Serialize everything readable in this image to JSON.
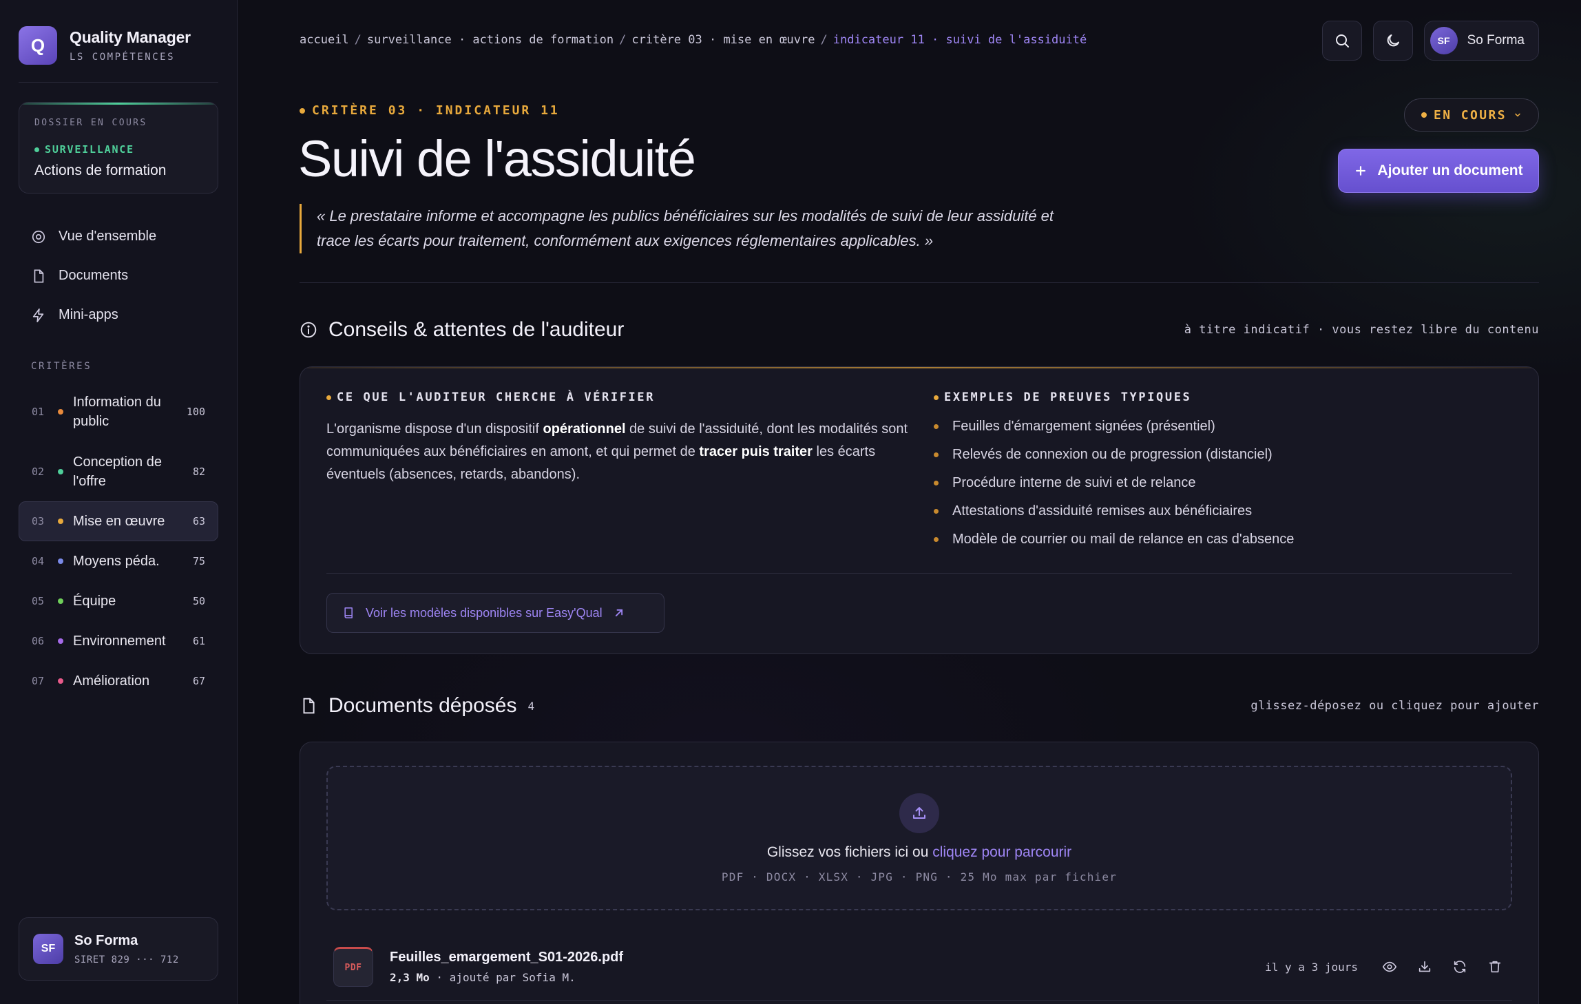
{
  "colors": {
    "accent": "#9f86f5",
    "orange": "#e8a93c",
    "green": "#4fcf9a"
  },
  "brand": {
    "logo_letter": "Q",
    "title": "Quality Manager",
    "subtitle": "LS COMPÉTENCES"
  },
  "dossier": {
    "label": "DOSSIER EN COURS",
    "tag": "SURVEILLANCE",
    "name": "Actions de formation"
  },
  "nav": [
    {
      "label": "Vue d'ensemble",
      "icon": "target-icon"
    },
    {
      "label": "Documents",
      "icon": "file-icon"
    },
    {
      "label": "Mini-apps",
      "icon": "lightning-icon"
    }
  ],
  "criteria": {
    "label": "CRITÈRES",
    "items": [
      {
        "num": "01",
        "name": "Information du public",
        "score": "100",
        "color": "#e88a3c"
      },
      {
        "num": "02",
        "name": "Conception de l'offre",
        "score": "82",
        "color": "#4fcf9a"
      },
      {
        "num": "03",
        "name": "Mise en œuvre",
        "score": "63",
        "color": "#e8a93c"
      },
      {
        "num": "04",
        "name": "Moyens péda.",
        "score": "75",
        "color": "#7a8ae8"
      },
      {
        "num": "05",
        "name": "Équipe",
        "score": "50",
        "color": "#6fcf5a"
      },
      {
        "num": "06",
        "name": "Environnement",
        "score": "61",
        "color": "#a56ae8"
      },
      {
        "num": "07",
        "name": "Amélioration",
        "score": "67",
        "color": "#e85a8a"
      }
    ]
  },
  "user": {
    "initials": "SF",
    "name": "So Forma",
    "siret": "SIRET 829 ··· 712"
  },
  "breadcrumb": {
    "parts": [
      "accueil",
      "surveillance · actions de formation",
      "critère 03 · mise en œuvre"
    ],
    "current": "indicateur 11 · suivi de l'assiduité"
  },
  "header": {
    "eyebrow": "CRITÈRE 03 · INDICATEUR 11",
    "title": "Suivi de l'assiduité",
    "status": "EN COURS",
    "add_button": "Ajouter un document",
    "quote": "« Le prestataire informe et accompagne les publics bénéficiaires sur les modalités de suivi de leur assiduité et trace les écarts pour traitement, conformément aux exigences réglementaires applicables. »"
  },
  "advice": {
    "title": "Conseils & attentes de l'auditeur",
    "hint": "à titre indicatif · vous restez libre du contenu",
    "left_label": "CE QUE L'AUDITEUR CHERCHE À VÉRIFIER",
    "left_text_1": "L'organisme dispose d'un dispositif ",
    "left_bold_1": "opérationnel",
    "left_text_2": " de suivi de l'assiduité, dont les modalités sont communiquées aux bénéficiaires en amont, et qui permet de ",
    "left_bold_2": "tracer puis traiter",
    "left_text_3": " les écarts éventuels (absences, retards, abandons).",
    "right_label": "EXEMPLES DE PREUVES TYPIQUES",
    "examples": [
      "Feuilles d'émargement signées (présentiel)",
      "Relevés de connexion ou de progression (distanciel)",
      "Procédure interne de suivi et de relance",
      "Attestations d'assiduité remises aux bénéficiaires",
      "Modèle de courrier ou mail de relance en cas d'absence"
    ],
    "models_link": "Voir les modèles disponibles sur Easy'Qual"
  },
  "documents": {
    "title": "Documents déposés",
    "count": "4",
    "hint": "glissez-déposez ou cliquez pour ajouter",
    "dropzone_text": "Glissez vos fichiers ici ou ",
    "dropzone_link": "cliquez pour parcourir",
    "formats": "PDF · DOCX · XLSX · JPG · PNG · 25 Mo max par fichier",
    "files": [
      {
        "type": "PDF",
        "name": "Feuilles_emargement_S01-2026.pdf",
        "size": "2,3 Mo",
        "meta": " · ajouté par Sofia M.",
        "time": "il y a 3 jours"
      }
    ]
  }
}
